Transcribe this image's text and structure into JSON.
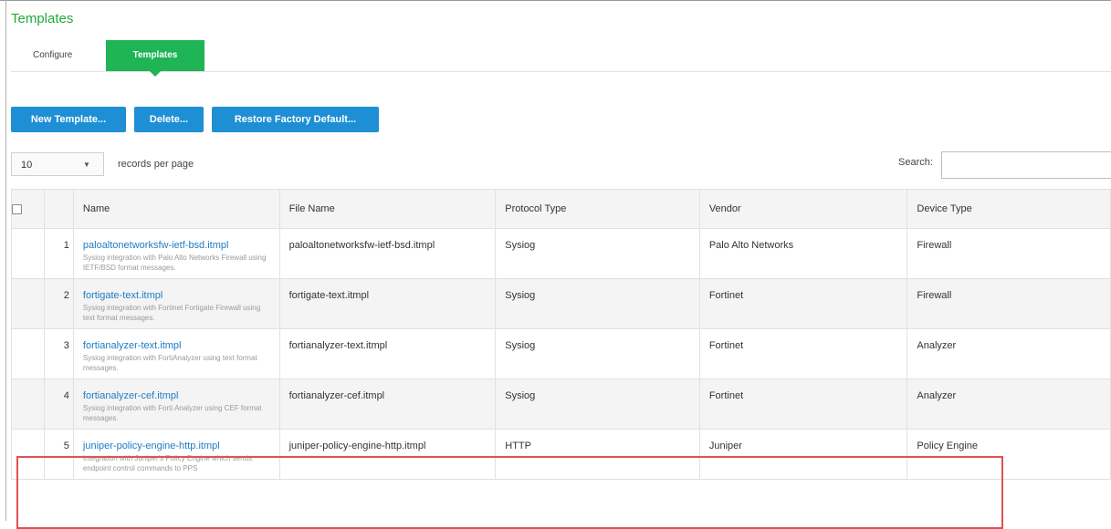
{
  "page": {
    "title": "Templates"
  },
  "tabs": [
    {
      "label": "Configure",
      "active": false
    },
    {
      "label": "Templates",
      "active": true
    }
  ],
  "toolbar": {
    "new_label": "New Template...",
    "delete_label": "Delete...",
    "restore_label": "Restore Factory Default..."
  },
  "records": {
    "value": "10",
    "label": "records per page"
  },
  "search": {
    "label": "Search:",
    "value": ""
  },
  "table": {
    "headers": [
      "Name",
      "File Name",
      "Protocol Type",
      "Vendor",
      "Device Type"
    ],
    "rows": [
      {
        "num": "1",
        "name": "paloaltonetworksfw-ietf-bsd.itmpl",
        "description": "Sysiog integration with Palo Alto Networks Firewall using IETF/BSD format messages.",
        "file": "paloaltonetworksfw-ietf-bsd.itmpl",
        "protocol": "Sysiog",
        "vendor": "Palo Alto Networks",
        "device": "Firewall"
      },
      {
        "num": "2",
        "name": "fortigate-text.itmpl",
        "description": "Sysiog integration with Fortinet Fortigate Firewall using text format messages.",
        "file": "fortigate-text.itmpl",
        "protocol": "Sysiog",
        "vendor": "Fortinet",
        "device": "Firewall"
      },
      {
        "num": "3",
        "name": "fortianalyzer-text.itmpl",
        "description": "Sysiog integration with FortiAnalyzer using text format messages.",
        "file": "fortianalyzer-text.itmpl",
        "protocol": "Sysiog",
        "vendor": "Fortinet",
        "device": "Analyzer"
      },
      {
        "num": "4",
        "name": "fortianalyzer-cef.itmpl",
        "description": "Sysiog integration with Forti Analyzer using CEF format messages.",
        "file": "fortianalyzer-cef.itmpl",
        "protocol": "Sysiog",
        "vendor": "Fortinet",
        "device": "Analyzer"
      },
      {
        "num": "5",
        "name": "juniper-policy-engine-http.itmpl",
        "description": "Integration with Juniper's Policy Engine which sends endpoint control commands to PPS",
        "file": "juniper-policy-engine-http.itmpl",
        "protocol": "HTTP",
        "vendor": "Juniper",
        "device": "Policy Engine"
      }
    ]
  },
  "colors": {
    "accent_green": "#1fb455",
    "button_blue": "#1e8fd4",
    "link_blue": "#1e7bc4",
    "highlight_red": "#e05252"
  }
}
